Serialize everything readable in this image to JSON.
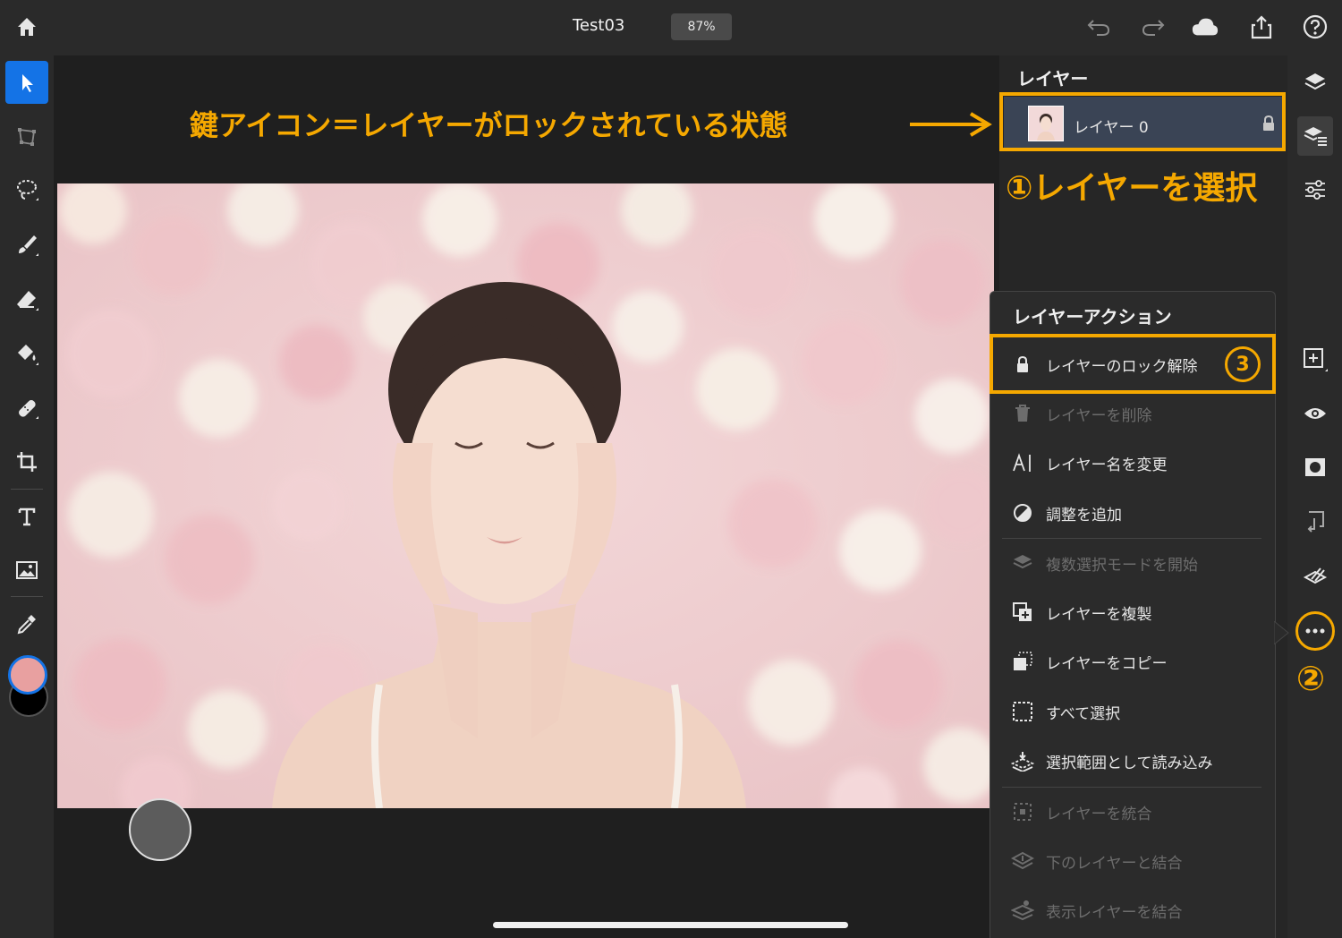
{
  "app": {
    "document_title": "Test03",
    "zoom": "87%"
  },
  "annotations": {
    "lock_note": "鍵アイコン＝レイヤーがロックされている状態",
    "step1": "①レイヤーを選択",
    "step2": "②",
    "step3": "③",
    "color": "#f5a800"
  },
  "layers_panel": {
    "title": "レイヤー",
    "layers": [
      {
        "name": "レイヤー 0",
        "locked": true
      }
    ]
  },
  "layer_actions_menu": {
    "title": "レイヤーアクション",
    "items": [
      {
        "label": "レイヤーのロック解除",
        "icon": "lock-icon",
        "enabled": true
      },
      {
        "label": "レイヤーを削除",
        "icon": "trash-icon",
        "enabled": false
      },
      {
        "label": "レイヤー名を変更",
        "icon": "rename-icon",
        "enabled": true
      },
      {
        "label": "調整を追加",
        "icon": "adjustment-icon",
        "enabled": true
      },
      {
        "label": "複数選択モードを開始",
        "icon": "multi-select-icon",
        "enabled": false
      },
      {
        "label": "レイヤーを複製",
        "icon": "duplicate-icon",
        "enabled": true
      },
      {
        "label": "レイヤーをコピー",
        "icon": "copy-icon",
        "enabled": true
      },
      {
        "label": "すべて選択",
        "icon": "select-all-icon",
        "enabled": true
      },
      {
        "label": "選択範囲として読み込み",
        "icon": "load-selection-icon",
        "enabled": true
      },
      {
        "label": "レイヤーを統合",
        "icon": "flatten-icon",
        "enabled": false
      },
      {
        "label": "下のレイヤーと結合",
        "icon": "merge-down-icon",
        "enabled": false
      },
      {
        "label": "表示レイヤーを結合",
        "icon": "merge-visible-icon",
        "enabled": false
      }
    ]
  },
  "colors": {
    "accent": "#1473e6",
    "foreground_swatch": "#e8a0a0",
    "background_swatch": "#000000"
  }
}
